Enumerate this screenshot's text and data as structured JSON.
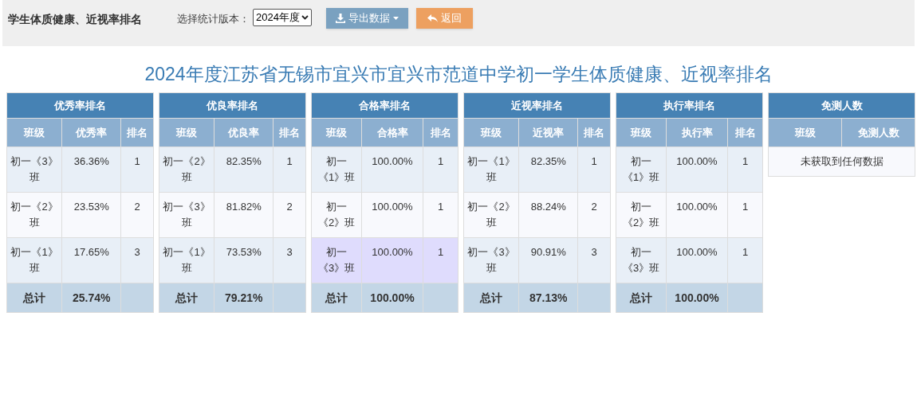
{
  "toolbar": {
    "title": "学生体质健康、近视率排名",
    "version_label": "选择统计版本：",
    "version_value": "2024年度",
    "export_button": "导出数据",
    "back_button": "返回"
  },
  "heading": "2024年度江苏省无锡市宜兴市宜兴市范道中学初一学生体质健康、近视率排名",
  "tables": [
    {
      "title": "优秀率排名",
      "columns": [
        "班级",
        "优秀率",
        "排名"
      ],
      "rows": [
        {
          "cells": [
            "初一《3》班",
            "36.36%",
            "1"
          ],
          "hovered": false
        },
        {
          "cells": [
            "初一《2》班",
            "23.53%",
            "2"
          ],
          "hovered": false
        },
        {
          "cells": [
            "初一《1》班",
            "17.65%",
            "3"
          ],
          "hovered": false
        }
      ],
      "total": [
        "总计",
        "25.74%"
      ]
    },
    {
      "title": "优良率排名",
      "columns": [
        "班级",
        "优良率",
        "排名"
      ],
      "rows": [
        {
          "cells": [
            "初一《2》班",
            "82.35%",
            "1"
          ],
          "hovered": false
        },
        {
          "cells": [
            "初一《3》班",
            "81.82%",
            "2"
          ],
          "hovered": false
        },
        {
          "cells": [
            "初一《1》班",
            "73.53%",
            "3"
          ],
          "hovered": false
        }
      ],
      "total": [
        "总计",
        "79.21%"
      ]
    },
    {
      "title": "合格率排名",
      "columns": [
        "班级",
        "合格率",
        "排名"
      ],
      "rows": [
        {
          "cells": [
            "初一《1》班",
            "100.00%",
            "1"
          ],
          "hovered": false
        },
        {
          "cells": [
            "初一《2》班",
            "100.00%",
            "1"
          ],
          "hovered": false
        },
        {
          "cells": [
            "初一《3》班",
            "100.00%",
            "1"
          ],
          "hovered": true
        }
      ],
      "total": [
        "总计",
        "100.00%"
      ]
    },
    {
      "title": "近视率排名",
      "columns": [
        "班级",
        "近视率",
        "排名"
      ],
      "rows": [
        {
          "cells": [
            "初一《1》班",
            "82.35%",
            "1"
          ],
          "hovered": false
        },
        {
          "cells": [
            "初一《2》班",
            "88.24%",
            "2"
          ],
          "hovered": false
        },
        {
          "cells": [
            "初一《3》班",
            "90.91%",
            "3"
          ],
          "hovered": false
        }
      ],
      "total": [
        "总计",
        "87.13%"
      ]
    },
    {
      "title": "执行率排名",
      "columns": [
        "班级",
        "执行率",
        "排名"
      ],
      "rows": [
        {
          "cells": [
            "初一《1》班",
            "100.00%",
            "1"
          ],
          "hovered": false
        },
        {
          "cells": [
            "初一《2》班",
            "100.00%",
            "1"
          ],
          "hovered": false
        },
        {
          "cells": [
            "初一《3》班",
            "100.00%",
            "1"
          ],
          "hovered": false
        }
      ],
      "total": [
        "总计",
        "100.00%"
      ]
    },
    {
      "title": "免测人数",
      "columns": [
        "班级",
        "免测人数"
      ],
      "empty_message": "未获取到任何数据"
    }
  ]
}
